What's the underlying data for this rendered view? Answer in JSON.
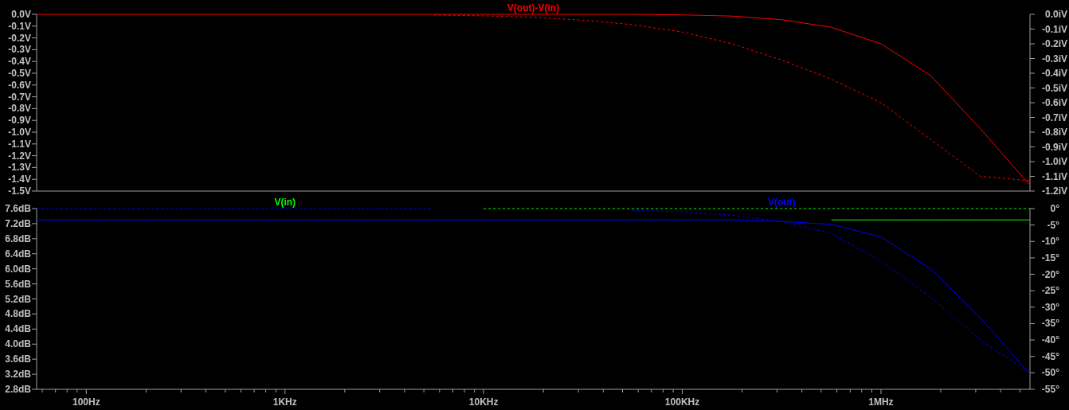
{
  "panes": [
    {
      "chart_data": {
        "type": "line",
        "categories": [
          null,
          null,
          null,
          null,
          null,
          null,
          null,
          null,
          null,
          null,
          null,
          null,
          null,
          null,
          null,
          null,
          null,
          null,
          null,
          null,
          null
        ],
        "ylim": [
          -1.5,
          0
        ],
        "yticks": [
          {
            "value": 0,
            "label": "0.0V"
          },
          {
            "value": -0.1,
            "label": "-0.1V"
          },
          {
            "value": -0.2,
            "label": "-0.2V"
          },
          {
            "value": -0.3,
            "label": "-0.3V"
          },
          {
            "value": -0.4,
            "label": "-0.4V"
          },
          {
            "value": -0.5,
            "label": "-0.5V"
          },
          {
            "value": -0.6,
            "label": "-0.6V"
          },
          {
            "value": -0.7,
            "label": "-0.7V"
          },
          {
            "value": -0.8,
            "label": "-0.8V"
          },
          {
            "value": -0.9,
            "label": "-0.9V"
          },
          {
            "value": -1.0,
            "label": "-1.0V"
          },
          {
            "value": -1.1,
            "label": "-1.1V"
          },
          {
            "value": -1.2,
            "label": "-1.2V"
          },
          {
            "value": -1.3,
            "label": "-1.3V"
          },
          {
            "value": -1.4,
            "label": "-1.4V"
          },
          {
            "value": -1.5,
            "label": "-1.5V"
          }
        ],
        "y2lim": [
          -1.2,
          0
        ],
        "y2ticks": [
          {
            "value": 0,
            "label": "0.0iV"
          },
          {
            "value": -0.1,
            "label": "-0.1iV"
          },
          {
            "value": -0.2,
            "label": "-0.2iV"
          },
          {
            "value": -0.3,
            "label": "-0.3iV"
          },
          {
            "value": -0.4,
            "label": "-0.4iV"
          },
          {
            "value": -0.5,
            "label": "-0.5iV"
          },
          {
            "value": -0.6,
            "label": "-0.6iV"
          },
          {
            "value": -0.7,
            "label": "-0.7iV"
          },
          {
            "value": -0.8,
            "label": "-0.8iV"
          },
          {
            "value": -0.9,
            "label": "-0.9iV"
          },
          {
            "value": -1.0,
            "label": "-1.0iV"
          },
          {
            "value": -1.1,
            "label": "-1.1iV"
          },
          {
            "value": -1.2,
            "label": "-1.2iV"
          }
        ],
        "series": [
          {
            "name": "V(out)-V(in)",
            "color": "#ff0000",
            "values": [
              0,
              0,
              0,
              0,
              0,
              0,
              0,
              0,
              0,
              0,
              0,
              0,
              0,
              -0.005,
              -0.015,
              -0.045,
              -0.11,
              -0.25,
              -0.52,
              -0.97,
              -1.45
            ]
          },
          {
            "color": "#ff0000",
            "axis": "y2",
            "line_style": "dashed",
            "values": [
              null,
              null,
              null,
              null,
              null,
              null,
              null,
              null,
              -0.005,
              -0.01,
              -0.02,
              -0.04,
              -0.07,
              -0.12,
              -0.2,
              -0.31,
              -0.44,
              -0.6,
              -0.85,
              -1.1,
              -1.13
            ]
          }
        ]
      }
    },
    {
      "chart_data": {
        "type": "line",
        "categories": [
          null,
          "100Hz",
          null,
          null,
          null,
          "1KHz",
          null,
          null,
          null,
          "10KHz",
          null,
          null,
          null,
          "100KHz",
          null,
          null,
          null,
          "1MHz",
          null,
          null,
          null
        ],
        "ylim": [
          2.8,
          7.6
        ],
        "yticks": [
          {
            "value": 7.6,
            "label": "7.6dB"
          },
          {
            "value": 7.2,
            "label": "7.2dB"
          },
          {
            "value": 6.8,
            "label": "6.8dB"
          },
          {
            "value": 6.4,
            "label": "6.4dB"
          },
          {
            "value": 6.0,
            "label": "6.0dB"
          },
          {
            "value": 5.6,
            "label": "5.6dB"
          },
          {
            "value": 5.2,
            "label": "5.2dB"
          },
          {
            "value": 4.8,
            "label": "4.8dB"
          },
          {
            "value": 4.4,
            "label": "4.4dB"
          },
          {
            "value": 4.0,
            "label": "4.0dB"
          },
          {
            "value": 3.6,
            "label": "3.6dB"
          },
          {
            "value": 3.2,
            "label": "3.2dB"
          },
          {
            "value": 2.8,
            "label": "2.8dB"
          }
        ],
        "y2lim": [
          -55,
          0
        ],
        "y2ticks": [
          {
            "value": 0,
            "label": "0°"
          },
          {
            "value": -5,
            "label": "-5°"
          },
          {
            "value": -10,
            "label": "-10°"
          },
          {
            "value": -15,
            "label": "-15°"
          },
          {
            "value": -20,
            "label": "-20°"
          },
          {
            "value": -25,
            "label": "-25°"
          },
          {
            "value": -30,
            "label": "-30°"
          },
          {
            "value": -35,
            "label": "-35°"
          },
          {
            "value": -40,
            "label": "-40°"
          },
          {
            "value": -45,
            "label": "-45°"
          },
          {
            "value": -50,
            "label": "-50°"
          },
          {
            "value": -55,
            "label": "-55°"
          }
        ],
        "series": [
          {
            "name": "V(in)",
            "color": "#00ff00",
            "values": [
              null,
              null,
              null,
              null,
              null,
              null,
              null,
              null,
              null,
              null,
              null,
              null,
              null,
              null,
              null,
              null,
              7.3,
              7.3,
              7.3,
              7.3,
              7.3
            ]
          },
          {
            "color": "#00ff00",
            "axis": "y2",
            "line_style": "dashed",
            "values": [
              null,
              null,
              null,
              null,
              null,
              null,
              null,
              null,
              null,
              0,
              0,
              0,
              0,
              0,
              0,
              0,
              0,
              0,
              0,
              0,
              0
            ]
          },
          {
            "name": "V(out)",
            "color": "#0000ff",
            "values": [
              7.3,
              7.3,
              7.3,
              7.3,
              7.3,
              7.3,
              7.3,
              7.3,
              7.3,
              7.3,
              7.3,
              7.3,
              7.3,
              7.3,
              7.3,
              7.26,
              7.18,
              6.85,
              6.0,
              4.7,
              3.2
            ]
          },
          {
            "color": "#0000ff",
            "axis": "y2",
            "line_style": "dashed",
            "values": [
              0,
              0,
              0,
              0,
              0,
              0,
              0,
              0,
              0,
              null,
              null,
              null,
              -0.5,
              -1,
              -2,
              -4,
              -7.5,
              -16,
              -27,
              -40,
              -50
            ]
          }
        ]
      }
    }
  ]
}
